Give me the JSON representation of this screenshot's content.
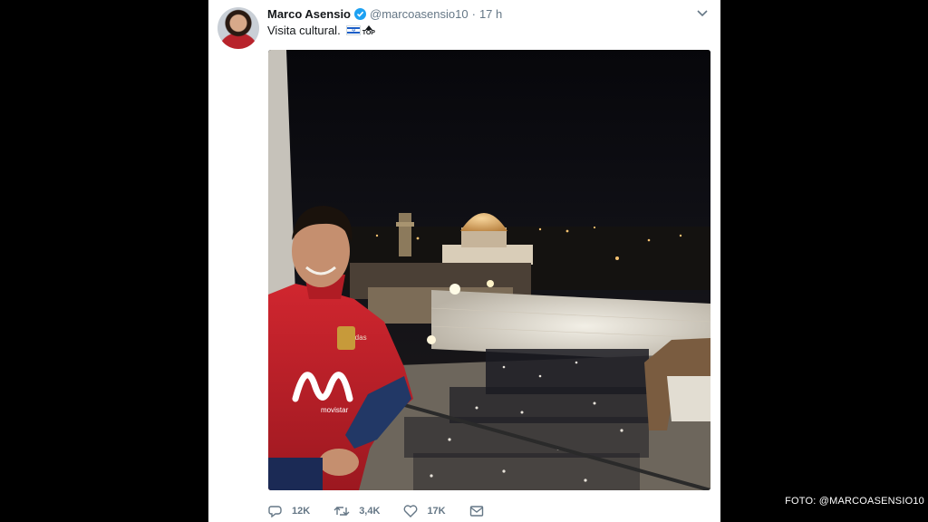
{
  "tweet": {
    "author_name": "Marco Asensio",
    "handle": "@marcoasensio10",
    "separator": "·",
    "time": "17 h",
    "text": "Visita cultural.",
    "emoji_top_label": "TOP",
    "icons": {
      "verified": "verified-badge-icon",
      "menu": "chevron-down-icon",
      "flag": "israel-flag-icon",
      "top": "top-arrow-emoji-icon"
    }
  },
  "actions": {
    "replies": "12K",
    "retweets": "3,4K",
    "likes": "17K",
    "icons": [
      "reply-icon",
      "retweet-icon",
      "like-icon",
      "message-icon"
    ]
  },
  "photo": {
    "shirt_text": "movistar"
  },
  "credit": "FOTO: @MARCOASENSIO10",
  "colors": {
    "background": "#000000",
    "card": "#ffffff",
    "name": "#14171a",
    "meta": "#657786",
    "verified": "#1da1f2",
    "shirt": "#c0202a"
  }
}
